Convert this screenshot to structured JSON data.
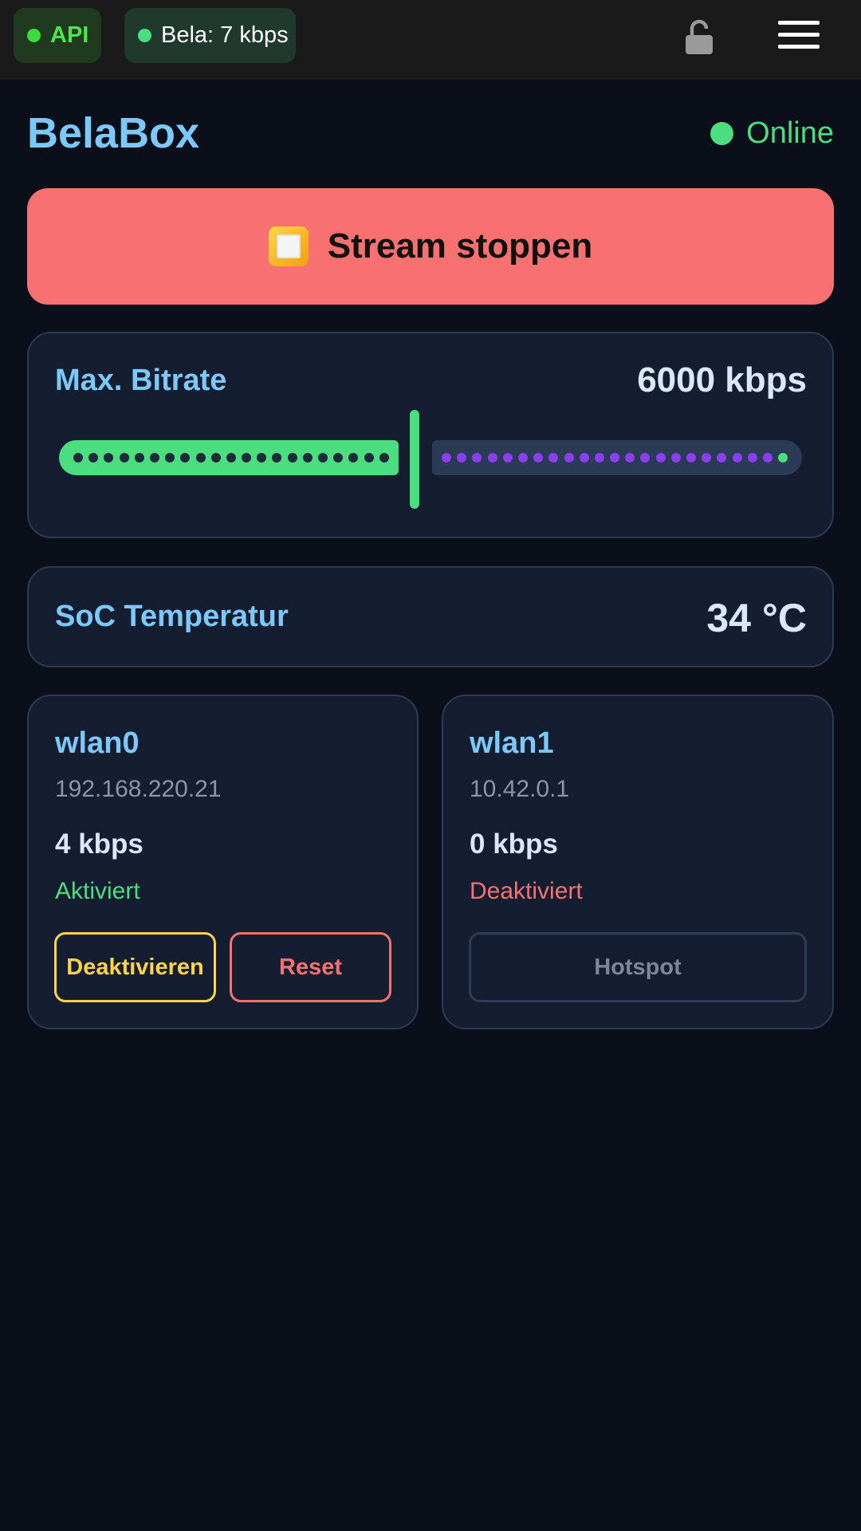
{
  "topbar": {
    "api_label": "API",
    "bela_status": "Bela: 7 kbps"
  },
  "header": {
    "title": "BelaBox",
    "status": "Online"
  },
  "stream_button": {
    "label": "Stream stoppen",
    "icon": "stop-square-icon"
  },
  "bitrate": {
    "label": "Max. Bitrate",
    "value": "6000 kbps",
    "slider_fraction": 0.47
  },
  "temperature": {
    "label": "SoC Temperatur",
    "value": "34 °C"
  },
  "interfaces": [
    {
      "name": "wlan0",
      "ip": "192.168.220.21",
      "rate": "4 kbps",
      "status": "Aktiviert",
      "status_color": "#4ade80",
      "buttons": [
        "Deaktivieren",
        "Reset"
      ]
    },
    {
      "name": "wlan1",
      "ip": "10.42.0.1",
      "rate": "0 kbps",
      "status": "Deaktiviert",
      "status_color": "#f87171",
      "buttons": [
        "Hotspot"
      ]
    }
  ],
  "colors": {
    "accent": "#7cc8f8",
    "success": "#4ade80",
    "danger": "#f87171",
    "warning": "#fcd34d",
    "slider_dots": "#8b3ff0"
  },
  "icons": {
    "lock": "lock-open-icon",
    "menu": "hamburger-menu-icon"
  }
}
